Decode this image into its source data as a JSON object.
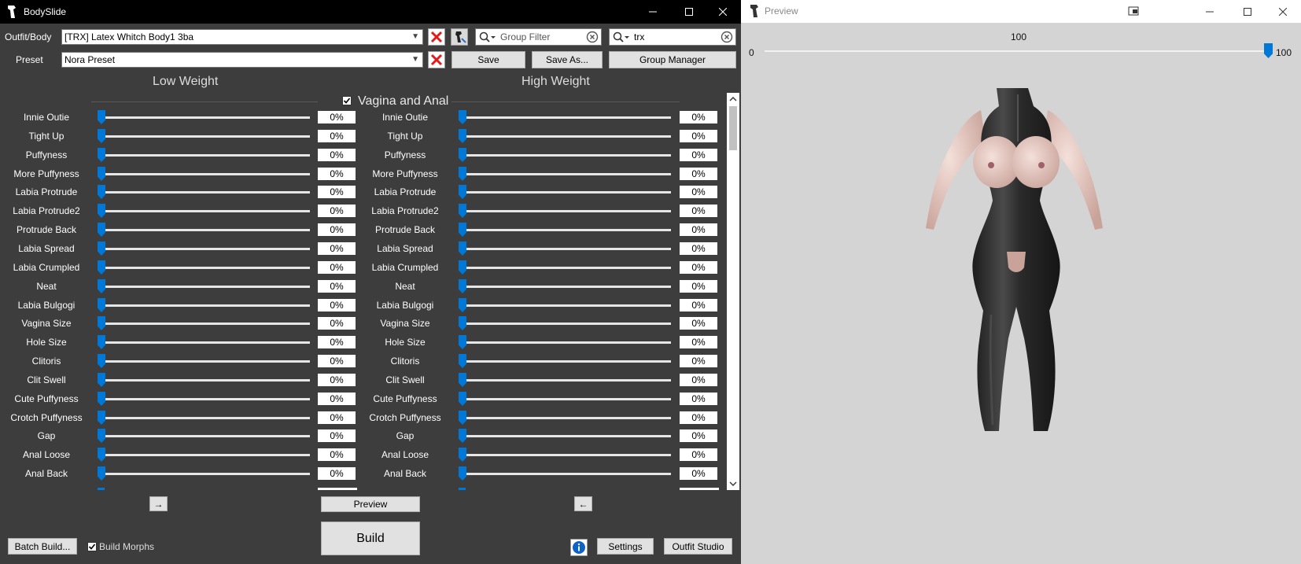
{
  "bodyslide": {
    "title": "BodySlide",
    "outfit_label": "Outfit/Body",
    "outfit_value": "[TRX] Latex Whitch Body1 3ba",
    "preset_label": "Preset",
    "preset_value": "Nora Preset",
    "group_filter_placeholder": "Group Filter",
    "outfit_filter_value": "trx",
    "save_label": "Save",
    "save_as_label": "Save As...",
    "group_manager_label": "Group Manager",
    "low_weight": "Low Weight",
    "high_weight": "High Weight",
    "category": "Vagina and Anal",
    "sliders": [
      {
        "name": "Innie Outie",
        "low": "0%",
        "high": "0%"
      },
      {
        "name": "Tight Up",
        "low": "0%",
        "high": "0%"
      },
      {
        "name": "Puffyness",
        "low": "0%",
        "high": "0%"
      },
      {
        "name": "More Puffyness",
        "low": "0%",
        "high": "0%"
      },
      {
        "name": "Labia Protrude",
        "low": "0%",
        "high": "0%"
      },
      {
        "name": "Labia Protrude2",
        "low": "0%",
        "high": "0%"
      },
      {
        "name": "Protrude Back",
        "low": "0%",
        "high": "0%"
      },
      {
        "name": "Labia Spread",
        "low": "0%",
        "high": "0%"
      },
      {
        "name": "Labia Crumpled",
        "low": "0%",
        "high": "0%"
      },
      {
        "name": "Neat",
        "low": "0%",
        "high": "0%"
      },
      {
        "name": "Labia Bulgogi",
        "low": "0%",
        "high": "0%"
      },
      {
        "name": "Vagina Size",
        "low": "0%",
        "high": "0%"
      },
      {
        "name": "Hole Size",
        "low": "0%",
        "high": "0%"
      },
      {
        "name": "Clitoris",
        "low": "0%",
        "high": "0%"
      },
      {
        "name": "Clit Swell",
        "low": "0%",
        "high": "0%"
      },
      {
        "name": "Cute Puffyness",
        "low": "0%",
        "high": "0%"
      },
      {
        "name": "Crotch Puffyness",
        "low": "0%",
        "high": "0%"
      },
      {
        "name": "Gap",
        "low": "0%",
        "high": "0%"
      },
      {
        "name": "Anal Loose",
        "low": "0%",
        "high": "0%"
      },
      {
        "name": "Anal Back",
        "low": "0%",
        "high": "0%"
      }
    ],
    "arrow_right": "→",
    "arrow_left": "←",
    "preview_label": "Preview",
    "build_label": "Build",
    "batch_build_label": "Batch Build...",
    "build_morphs_label": "Build Morphs",
    "settings_label": "Settings",
    "outfit_studio_label": "Outfit Studio"
  },
  "preview": {
    "title": "Preview",
    "weight_display": "100",
    "min_label": "0",
    "max_label": "100",
    "weight": 100
  },
  "colors": {
    "accent": "#0078d7",
    "panel": "#3d3d3d",
    "preview_bg": "#d4d4d4"
  }
}
